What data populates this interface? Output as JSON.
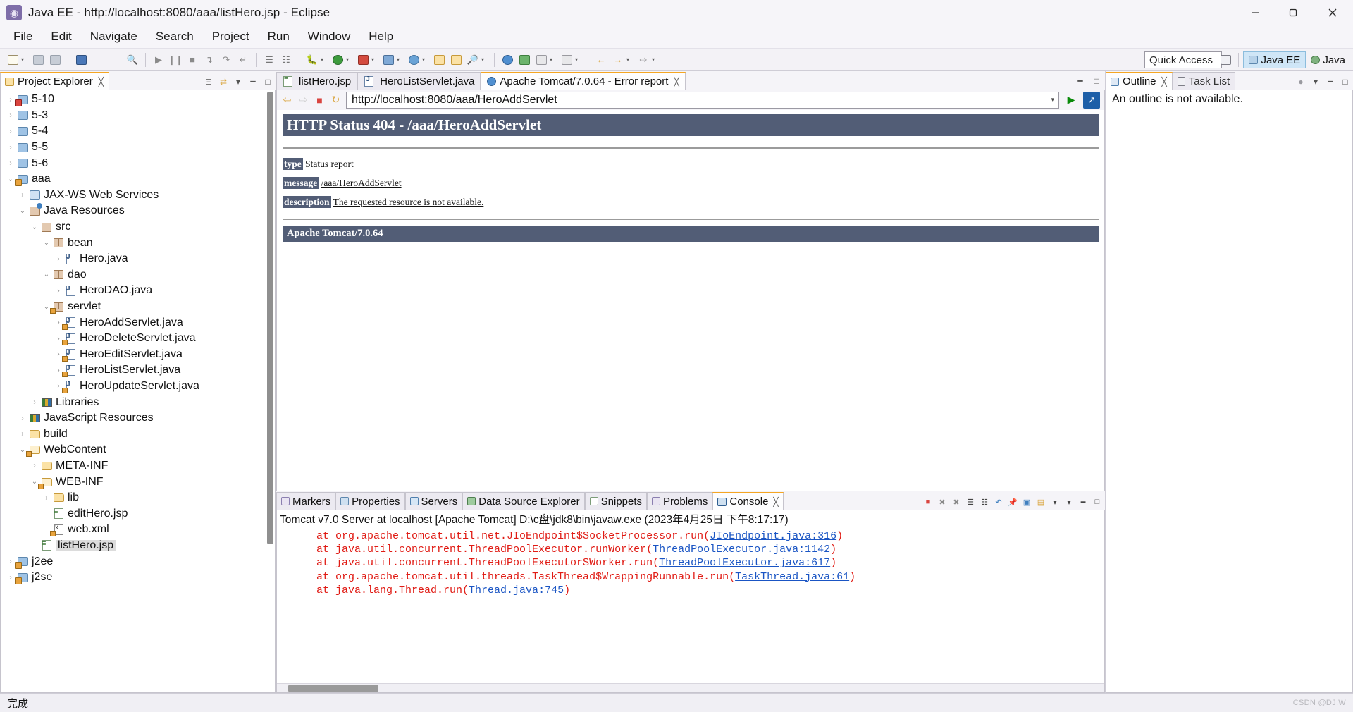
{
  "window": {
    "title": "Java EE - http://localhost:8080/aaa/listHero.jsp - Eclipse",
    "app_icon": "eclipse-icon",
    "minimize": "—",
    "maximize": "❐",
    "close": "✕"
  },
  "menubar": {
    "items": [
      "File",
      "Edit",
      "Navigate",
      "Search",
      "Project",
      "Run",
      "Window",
      "Help"
    ]
  },
  "toolbar": {
    "quick_access_placeholder": "Quick Access",
    "open_perspective_icon": "open-perspective-icon",
    "perspectives": [
      {
        "label": "Java EE",
        "active": true
      },
      {
        "label": "Java",
        "active": false
      }
    ]
  },
  "project_explorer": {
    "tab_label": "Project Explorer",
    "tab_icon": "project-explorer-icon",
    "tab_close": "╳",
    "tools": [
      "collapse-all-icon",
      "link-with-editor-icon",
      "view-menu-icon",
      "minimize-icon",
      "maximize-icon"
    ],
    "tree": [
      {
        "label": "5-10",
        "depth": 0,
        "twisty": "collapsed",
        "icon": "project-error-icon"
      },
      {
        "label": "5-3",
        "depth": 0,
        "twisty": "collapsed",
        "icon": "project-icon"
      },
      {
        "label": "5-4",
        "depth": 0,
        "twisty": "collapsed",
        "icon": "project-icon"
      },
      {
        "label": "5-5",
        "depth": 0,
        "twisty": "collapsed",
        "icon": "project-icon"
      },
      {
        "label": "5-6",
        "depth": 0,
        "twisty": "collapsed",
        "icon": "project-icon"
      },
      {
        "label": "aaa",
        "depth": 0,
        "twisty": "expanded",
        "icon": "project-warning-icon"
      },
      {
        "label": "JAX-WS Web Services",
        "depth": 1,
        "twisty": "collapsed",
        "icon": "web-services-icon"
      },
      {
        "label": "Java Resources",
        "depth": 1,
        "twisty": "expanded",
        "icon": "java-resources-icon"
      },
      {
        "label": "src",
        "depth": 2,
        "twisty": "expanded",
        "icon": "source-folder-icon"
      },
      {
        "label": "bean",
        "depth": 3,
        "twisty": "expanded",
        "icon": "package-icon"
      },
      {
        "label": "Hero.java",
        "depth": 4,
        "twisty": "collapsed",
        "icon": "java-file-icon"
      },
      {
        "label": "dao",
        "depth": 3,
        "twisty": "expanded",
        "icon": "package-icon"
      },
      {
        "label": "HeroDAO.java",
        "depth": 4,
        "twisty": "collapsed",
        "icon": "java-file-icon"
      },
      {
        "label": "servlet",
        "depth": 3,
        "twisty": "expanded",
        "icon": "package-warning-icon"
      },
      {
        "label": "HeroAddServlet.java",
        "depth": 4,
        "twisty": "collapsed",
        "icon": "java-file-warning-icon"
      },
      {
        "label": "HeroDeleteServlet.java",
        "depth": 4,
        "twisty": "collapsed",
        "icon": "java-file-warning-icon"
      },
      {
        "label": "HeroEditServlet.java",
        "depth": 4,
        "twisty": "collapsed",
        "icon": "java-file-warning-icon"
      },
      {
        "label": "HeroListServlet.java",
        "depth": 4,
        "twisty": "collapsed",
        "icon": "java-file-warning-icon"
      },
      {
        "label": "HeroUpdateServlet.java",
        "depth": 4,
        "twisty": "collapsed",
        "icon": "java-file-warning-icon"
      },
      {
        "label": "Libraries",
        "depth": 2,
        "twisty": "collapsed",
        "icon": "libraries-icon"
      },
      {
        "label": "JavaScript Resources",
        "depth": 1,
        "twisty": "collapsed",
        "icon": "libraries-icon"
      },
      {
        "label": "build",
        "depth": 1,
        "twisty": "collapsed",
        "icon": "folder-icon"
      },
      {
        "label": "WebContent",
        "depth": 1,
        "twisty": "expanded",
        "icon": "folder-warning-icon"
      },
      {
        "label": "META-INF",
        "depth": 2,
        "twisty": "collapsed",
        "icon": "folder-icon"
      },
      {
        "label": "WEB-INF",
        "depth": 2,
        "twisty": "expanded",
        "icon": "folder-warning-icon"
      },
      {
        "label": "lib",
        "depth": 3,
        "twisty": "collapsed",
        "icon": "folder-icon"
      },
      {
        "label": "editHero.jsp",
        "depth": 3,
        "twisty": "none",
        "icon": "jsp-file-icon"
      },
      {
        "label": "web.xml",
        "depth": 3,
        "twisty": "none",
        "icon": "xml-file-warning-icon"
      },
      {
        "label": "listHero.jsp",
        "depth": 2,
        "twisty": "none",
        "icon": "jsp-file-icon",
        "selected": true
      },
      {
        "label": "j2ee",
        "depth": 0,
        "twisty": "collapsed",
        "icon": "project-warning-icon"
      },
      {
        "label": "j2se",
        "depth": 0,
        "twisty": "collapsed",
        "icon": "project-warning-icon"
      }
    ]
  },
  "editor": {
    "tabs": [
      {
        "label": "listHero.jsp",
        "icon": "jsp-file-icon",
        "active": false,
        "close": ""
      },
      {
        "label": "HeroListServlet.java",
        "icon": "java-file-icon",
        "active": false,
        "close": ""
      },
      {
        "label": "Apache Tomcat/7.0.64 - Error report",
        "icon": "browser-icon",
        "active": true,
        "close": "╳"
      }
    ],
    "tools": [
      "view-menu-icon",
      "minimize-icon",
      "maximize-icon"
    ],
    "browser": {
      "back_icon": "back-arrow-icon",
      "forward_icon": "forward-arrow-icon",
      "stop_icon": "stop-icon",
      "refresh_icon": "refresh-icon",
      "url": "http://localhost:8080/aaa/HeroAddServlet",
      "url_dropdown_icon": "chevron-down-icon",
      "go_icon": "go-icon",
      "open_external_icon": "open-external-browser-icon"
    },
    "error_page": {
      "status_heading": "HTTP Status 404 - /aaa/HeroAddServlet",
      "rows": [
        {
          "key": "type",
          "value": "Status report",
          "link": false
        },
        {
          "key": "message",
          "value": "/aaa/HeroAddServlet",
          "link": true
        },
        {
          "key": "description",
          "value": "The requested resource is not available.",
          "underline": true
        }
      ],
      "footer": "Apache Tomcat/7.0.64"
    }
  },
  "bottom_panel": {
    "tabs": [
      {
        "label": "Markers",
        "icon": "markers-icon",
        "active": false
      },
      {
        "label": "Properties",
        "icon": "properties-icon",
        "active": false
      },
      {
        "label": "Servers",
        "icon": "servers-icon",
        "active": false
      },
      {
        "label": "Data Source Explorer",
        "icon": "data-source-icon",
        "active": false
      },
      {
        "label": "Snippets",
        "icon": "snippets-icon",
        "active": false
      },
      {
        "label": "Problems",
        "icon": "problems-icon",
        "active": false
      },
      {
        "label": "Console",
        "icon": "console-icon",
        "active": true,
        "close": "╳"
      }
    ],
    "tools": [
      "terminate-icon",
      "remove-launch-icon",
      "remove-all-icon",
      "clear-console-icon",
      "scroll-lock-icon",
      "word-wrap-icon",
      "pin-console-icon",
      "display-console-icon",
      "open-console-icon",
      "new-console-view-icon",
      "view-menu-icon",
      "minimize-icon",
      "maximize-icon"
    ],
    "console_header": "Tomcat v7.0 Server at localhost [Apache Tomcat] D:\\c盘\\jdk8\\bin\\javaw.exe (2023年4月25日 下午8:17:17)",
    "console_lines": [
      {
        "text": "at org.apache.tomcat.util.net.JIoEndpoint$SocketProcessor.run(",
        "link": "JIoEndpoint.java:316",
        "tail": ")"
      },
      {
        "text": "at java.util.concurrent.ThreadPoolExecutor.runWorker(",
        "link": "ThreadPoolExecutor.java:1142",
        "tail": ")"
      },
      {
        "text": "at java.util.concurrent.ThreadPoolExecutor$Worker.run(",
        "link": "ThreadPoolExecutor.java:617",
        "tail": ")"
      },
      {
        "text": "at org.apache.tomcat.util.threads.TaskThread$WrappingRunnable.run(",
        "link": "TaskThread.java:61",
        "tail": ")"
      },
      {
        "text": "at java.lang.Thread.run(",
        "link": "Thread.java:745",
        "tail": ")"
      }
    ]
  },
  "right_panel": {
    "tabs": [
      {
        "label": "Outline",
        "icon": "outline-icon",
        "active": true,
        "close": "╳"
      },
      {
        "label": "Task List",
        "icon": "task-list-icon",
        "active": false,
        "close": ""
      }
    ],
    "tools": [
      "focus-icon",
      "view-menu-icon",
      "minimize-icon",
      "maximize-icon"
    ],
    "outline_message": "An outline is not available."
  },
  "statusbar": {
    "message": "完成",
    "watermark": "CSDN @DJ.W"
  },
  "colors": {
    "accent_tab": "#f5a623",
    "tomcat_banner": "#525d76",
    "console_error": "#e01b14",
    "console_link": "#1a55c4",
    "perspective_active": "#cfe6f7",
    "selection": "#dcdcdc"
  }
}
